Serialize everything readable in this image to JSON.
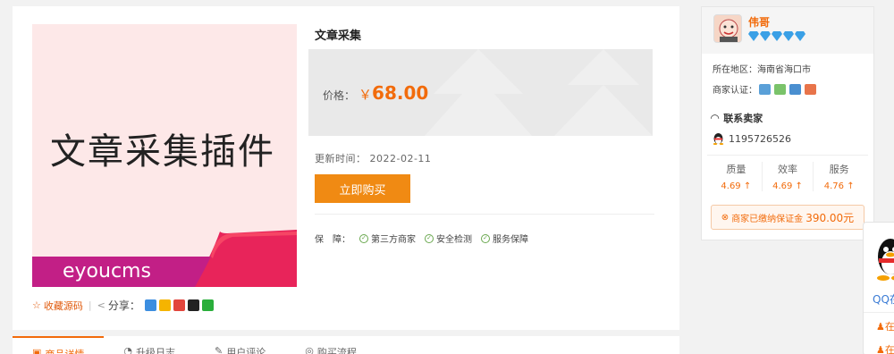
{
  "product": {
    "image_text": "文章采集插件",
    "image_brand": "eyoucms",
    "title": "文章采集",
    "price_label": "价格：",
    "price_currency": "￥",
    "price_value": "68.00",
    "update_label": "更新时间：",
    "update_date": "2022-02-11",
    "buy_label": "立即购买",
    "guarantee_label": "保　障：",
    "guarantees": [
      "第三方商家",
      "安全检测",
      "服务保障"
    ],
    "favorite_label": "收藏源码",
    "share_label": "分享："
  },
  "tabs": [
    "商品详情",
    "升级日志",
    "用户评论",
    "购买流程"
  ],
  "seller": {
    "name": "伟哥",
    "region_label": "所在地区：",
    "region": "海南省海口市",
    "auth_label": "商家认证：",
    "contact_label": "联系卖家",
    "qq": "1195726526",
    "scores": [
      {
        "label": "质量",
        "value": "4.69"
      },
      {
        "label": "效率",
        "value": "4.69"
      },
      {
        "label": "服务",
        "value": "4.76"
      }
    ],
    "deposit_text": "商家已缴纳保证金",
    "deposit_amount": "390.00元"
  },
  "float": {
    "qq_text": "QQ在线",
    "row1": "在",
    "row2": "在"
  },
  "colors": {
    "accent": "#f26b0b",
    "buy_button": "#f08a13",
    "diamond": "#3aa0e6"
  }
}
